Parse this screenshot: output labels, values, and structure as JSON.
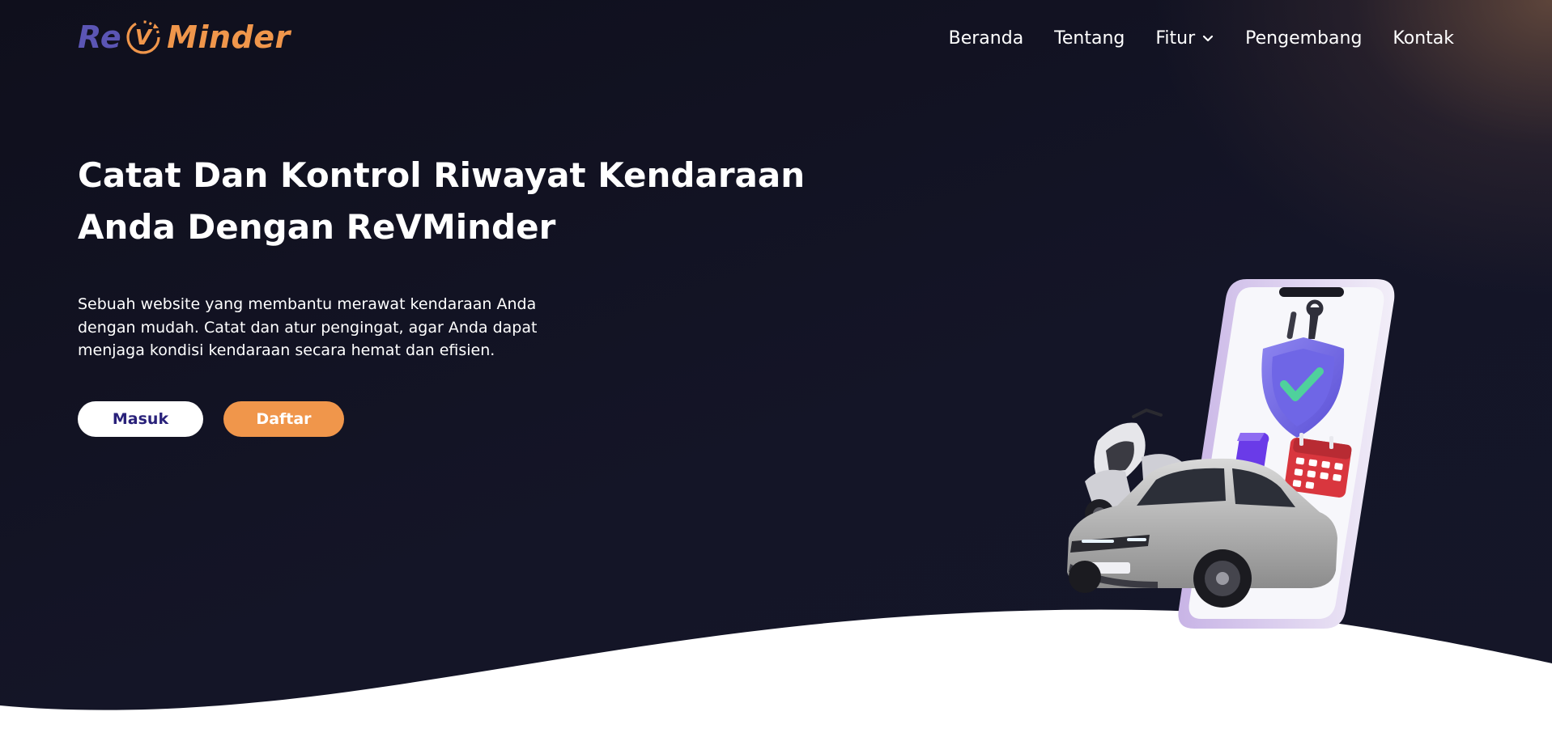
{
  "brand": {
    "logo_prefix": "Re",
    "logo_mark": "V",
    "logo_suffix": "Minder",
    "colors": {
      "purple": "#5b55b4",
      "orange": "#f0964b",
      "dark_bg": "#141527",
      "button_text_dark": "#29217a"
    }
  },
  "nav": {
    "items": [
      {
        "label": "Beranda"
      },
      {
        "label": "Tentang"
      },
      {
        "label": "Fitur",
        "icon": "chevron-down-icon"
      },
      {
        "label": "Pengembang"
      },
      {
        "label": "Kontak"
      }
    ]
  },
  "hero": {
    "headline": "Catat Dan Kontrol Riwayat Kendaraan Anda Dengan ReVMinder",
    "description": "Sebuah website yang membantu merawat kendaraan Anda dengan mudah. Catat dan atur pengingat, agar Anda dapat menjaga kondisi kendaraan secara hemat dan efisien.",
    "buttons": {
      "login_label": "Masuk",
      "register_label": "Daftar"
    },
    "illustration": {
      "icons": [
        "smartphone-icon",
        "shield-check-icon",
        "wrench-icon",
        "bookmark-icon",
        "calendar-icon",
        "motorcycle-icon",
        "car-icon"
      ]
    }
  }
}
